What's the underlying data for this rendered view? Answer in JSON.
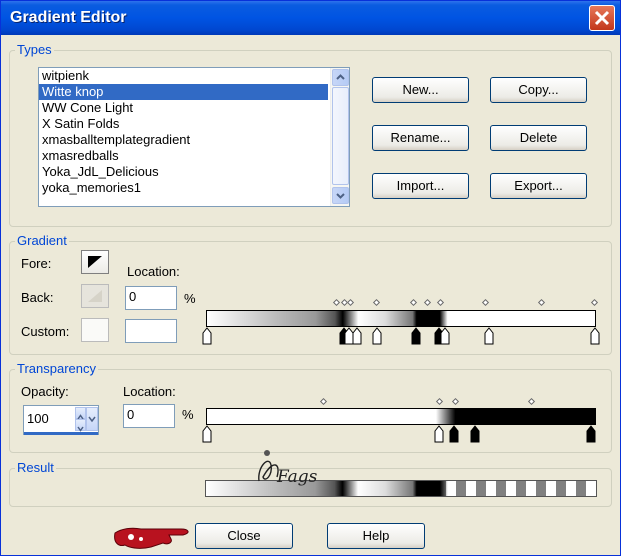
{
  "window": {
    "title": "Gradient Editor"
  },
  "types": {
    "group_label": "Types",
    "items": [
      "witpienk",
      "Witte knop",
      "WW Cone Light",
      "X Satin Folds",
      "xmasballtemplategradient",
      "xmasredballs",
      "Yoka_JdL_Delicious",
      "yoka_memories1"
    ],
    "selected_index": 1,
    "buttons": {
      "new": "New...",
      "copy": "Copy...",
      "rename": "Rename...",
      "delete": "Delete",
      "import": "Import...",
      "export": "Export..."
    }
  },
  "gradient": {
    "group_label": "Gradient",
    "fore_label": "Fore:",
    "back_label": "Back:",
    "custom_label": "Custom:",
    "location_label": "Location:",
    "location_value": "0",
    "percent": "%"
  },
  "transparency": {
    "group_label": "Transparency",
    "opacity_label": "Opacity:",
    "opacity_value": "100",
    "location_label": "Location:",
    "location_value": "0",
    "percent": "%"
  },
  "result": {
    "group_label": "Result",
    "watermark": "Fags"
  },
  "footer": {
    "close": "Close",
    "help": "Help"
  },
  "colors": {
    "title_bar": "#0054e3",
    "selection": "#316ac5",
    "group_label": "#0046d5"
  }
}
